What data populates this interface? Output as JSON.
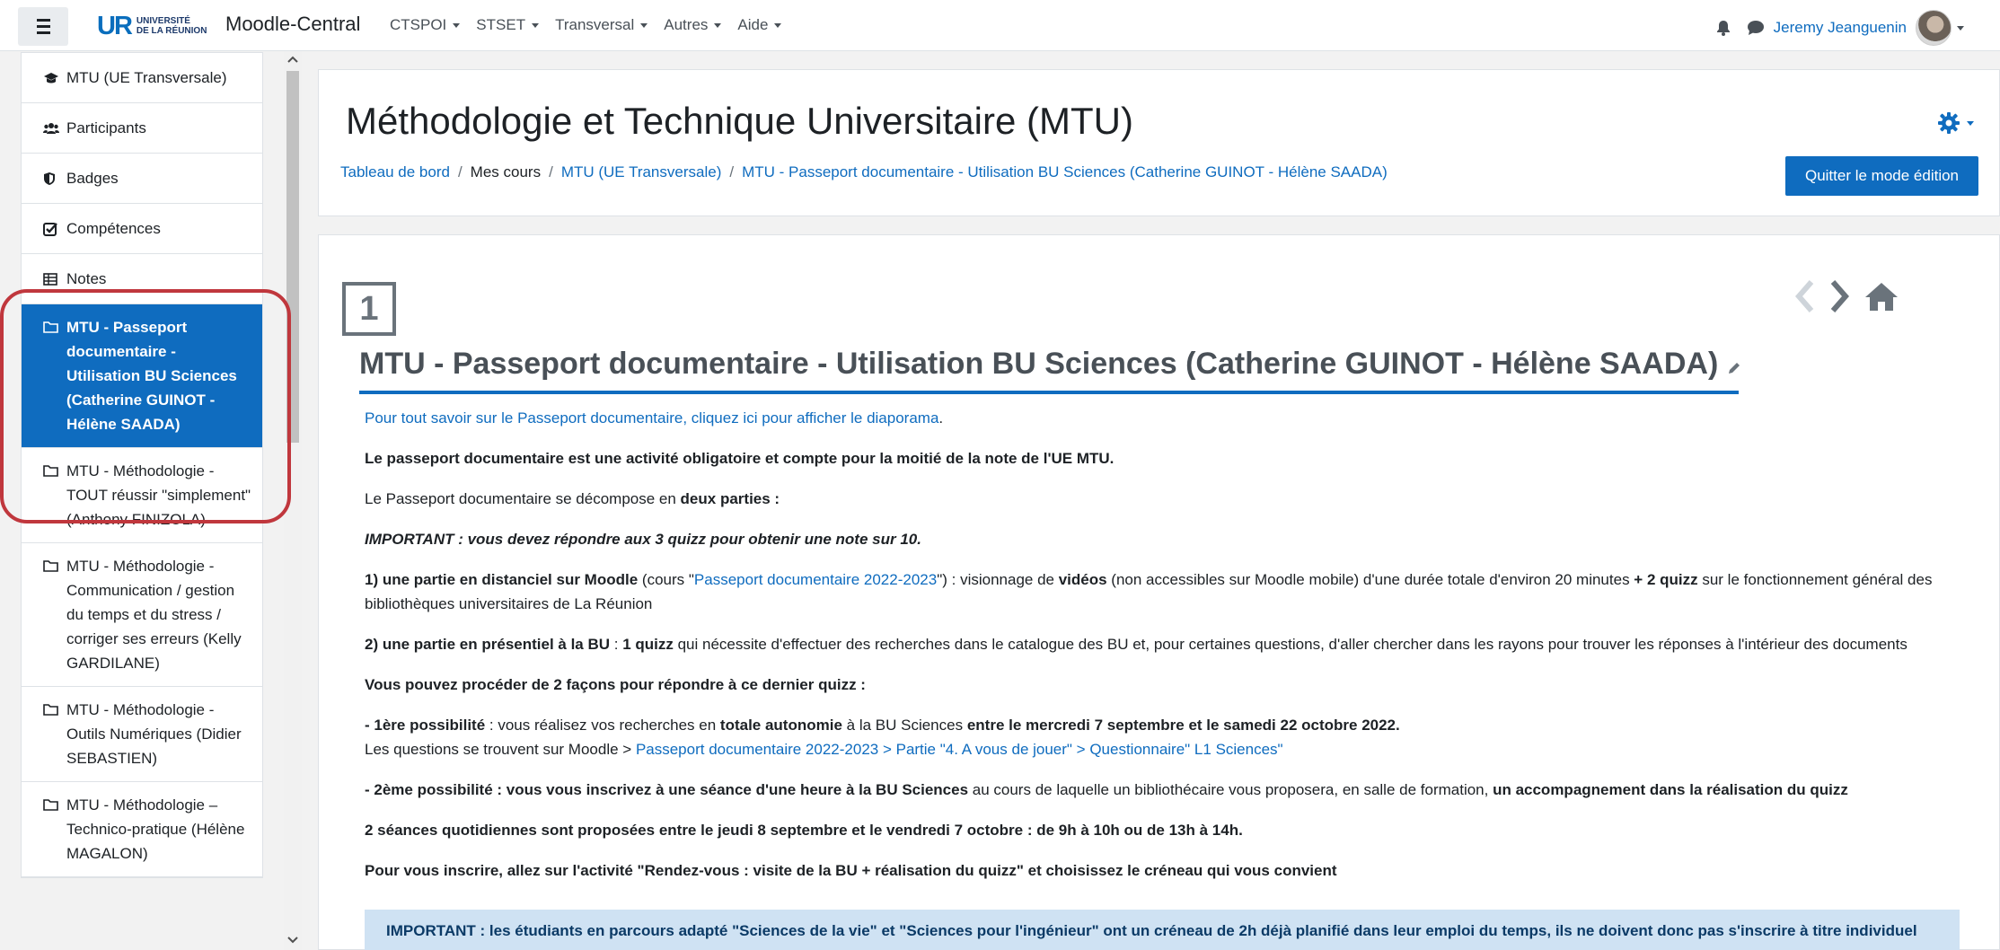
{
  "navbar": {
    "logo_letters": "UR",
    "logo_line1": "UNIVERSITÉ",
    "logo_line2": "DE LA RÉUNION",
    "site_name": "Moodle-Central",
    "menu": [
      "CTSPOI",
      "STSET",
      "Transversal",
      "Autres",
      "Aide"
    ],
    "user_name": "Jeremy Jeanguenin"
  },
  "sidebar": {
    "items": [
      {
        "icon": "graduation-cap-icon",
        "label": "MTU (UE Transversale)"
      },
      {
        "icon": "users-icon",
        "label": "Participants"
      },
      {
        "icon": "shield-icon",
        "label": "Badges"
      },
      {
        "icon": "checkbox-icon",
        "label": "Compétences"
      },
      {
        "icon": "table-icon",
        "label": "Notes"
      },
      {
        "icon": "folder-icon",
        "label": "MTU - Passeport documentaire - Utilisation BU Sciences (Catherine GUINOT - Hélène SAADA)",
        "active": true
      },
      {
        "icon": "folder-icon",
        "label": "MTU - Méthodologie - TOUT réussir \"simplement\" (Anthony FINIZOLA)"
      },
      {
        "icon": "folder-icon",
        "label": "MTU - Méthodologie - Communication / gestion du temps et du stress / corriger ses erreurs (Kelly GARDILANE)"
      },
      {
        "icon": "folder-icon",
        "label": "MTU - Méthodologie - Outils Numériques (Didier SEBASTIEN)"
      },
      {
        "icon": "folder-icon",
        "label": "MTU - Méthodologie – Technico-pratique (Hélène MAGALON)"
      }
    ]
  },
  "header": {
    "title": "Méthodologie et Technique Universitaire (MTU)",
    "breadcrumb": [
      "Tableau de bord",
      "Mes cours",
      "MTU (UE Transversale)",
      "MTU - Passeport documentaire - Utilisation BU Sciences (Catherine GUINOT - Hélène SAADA)"
    ],
    "quit_edit_label": "Quitter le mode édition"
  },
  "section": {
    "number": "1",
    "title": "MTU - Passeport documentaire - Utilisation BU Sciences (Catherine GUINOT - Hélène SAADA)",
    "intro_link": "Pour tout savoir sur le Passeport documentaire, cliquez ici pour afficher le diaporama",
    "p1": "Le passeport documentaire est une activité obligatoire et compte pour la moitié de la note de l'UE MTU.",
    "p2_a": "Le Passeport documentaire se décompose en ",
    "p2_b": "deux parties :",
    "p3": "IMPORTANT : vous devez répondre aux 3 quizz pour obtenir une note sur 10.",
    "p4_a": "1) une partie en distanciel sur Moodle",
    "p4_b": " (cours \"",
    "p4_link": "Passeport documentaire 2022-2023",
    "p4_c": "\") : visionnage de ",
    "p4_d": "vidéos",
    "p4_e": " (non accessibles sur Moodle mobile) d'une durée totale d'environ 20 minutes ",
    "p4_f": "+ 2 quizz",
    "p4_g": " sur le fonctionnement général des bibliothèques universitaires de La Réunion",
    "p5_a": "2) une partie en présentiel à la BU",
    "p5_b": " : ",
    "p5_c": "1 quizz",
    "p5_d": " qui nécessite d'effectuer des recherches dans le catalogue des BU et, pour certaines questions, d'aller chercher dans les rayons pour trouver les réponses à l'intérieur des documents",
    "p6": "Vous pouvez procéder de 2 façons pour répondre à ce dernier quizz :",
    "p7_a": "- 1ère possibilité",
    "p7_b": " : vous réalisez vos recherches en ",
    "p7_c": "totale autonomie",
    "p7_d": " à la BU Sciences ",
    "p7_e": "entre le mercredi 7 septembre et le samedi 22 octobre 2022.",
    "p7_f": "Les questions se trouvent sur Moodle > ",
    "p7_link": "Passeport documentaire 2022-2023 > Partie \"4. A vous de jouer\" > Questionnaire\" L1 Sciences\"",
    "p8_a": "- 2ème possibilité",
    "p8_b": " : vous vous inscrivez à une séance d'une heure à la BU Sciences",
    "p8_c": " au cours de laquelle un bibliothécaire vous proposera, en salle de formation, ",
    "p8_d": "un accompagnement dans la réalisation du quizz",
    "p9": "2 séances quotidiennes sont proposées entre le jeudi 8 septembre et le vendredi 7 octobre : de 9h à 10h ou de 13h à 14h.",
    "p10": "Pour vous inscrire, allez sur l'activité \"Rendez-vous : visite de la BU + réalisation du quizz\" et choisissez le créneau qui vous convient",
    "important_box": "IMPORTANT : les étudiants en parcours adapté \"Sciences de la vie\" et \"Sciences pour l'ingénieur\" ont un créneau de 2h déjà planifié dans leur emploi du temps, ils ne doivent donc pas s'inscrire à titre individuel"
  },
  "colors": {
    "brand_blue": "#0f6cbf",
    "highlight_ring": "#c0373d",
    "important_bg": "#cfe2f3"
  }
}
